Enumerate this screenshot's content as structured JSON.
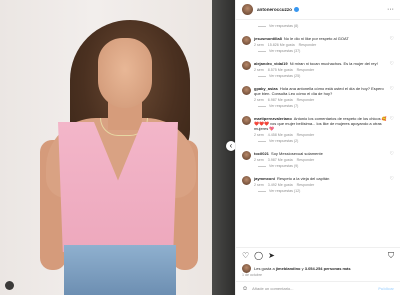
{
  "post": {
    "username": "antoneroccuzzo",
    "more_icon": "ellipsis-icon",
    "prev_nav_icon": "chevron-left-icon"
  },
  "comments": [
    {
      "id": "c0",
      "user": "",
      "text": "",
      "reply_toggle": "Ver respuestas (8)"
    },
    {
      "id": "c1",
      "user": "jesusmontilla8",
      "text": "No le dio ni like por respeto al GOAT",
      "time": "2 sem",
      "likes": "15.826 Me gusta",
      "reply": "Responder",
      "replies": "Ver respuestas (37)"
    },
    {
      "id": "c2",
      "user": "alejandro_vidal19",
      "text": "Ni miran ni tocan muchachos. Es la mujer del rey!",
      "time": "2 sem",
      "likes": "8.575 Me gusta",
      "reply": "Responder",
      "replies": "Ver respuestas (25)"
    },
    {
      "id": "c3",
      "user": "gpaky_asias",
      "text": "Hola ana antonella cómo está usted el día de hoy? Espero que bien. Consulta Leo cómo el día de hoy?",
      "time": "2 sem",
      "likes": "6.987 Me gusta",
      "reply": "Responder",
      "replies": "Ver respuestas (7)"
    },
    {
      "id": "c4",
      "user": "martiperezvaleriano",
      "text": "Antonio los comentarios de respeto de los chicos 🥰❤️❤️❤️ vos que mujer bellísima... los like de mujeres apoyando a otras mujeres 💖",
      "time": "2 sem",
      "likes": "4.458 Me gusta",
      "reply": "Responder",
      "replies": "Ver respuestas (2)"
    },
    {
      "id": "c5",
      "user": "tocil021",
      "text": "Soy Messiosexual solamente",
      "time": "2 sem",
      "likes": "3.987 Me gusta",
      "reply": "Responder",
      "replies": "Ver respuestas (9)"
    },
    {
      "id": "c6",
      "user": "jaymmxoni",
      "text": "Respeto a la viejа del capitán",
      "time": "2 sem",
      "likes": "3.492 Me gusta",
      "reply": "Responder",
      "replies": "Ver respuestas (12)"
    }
  ],
  "likes_line": {
    "prefix": "Les gusta a",
    "user": "jimeblandino",
    "middle": "y",
    "count": "3.054.254 personas más"
  },
  "date": "1 de octubre",
  "add_comment": {
    "placeholder": "Añade un comentario...",
    "publish": "Publicar"
  },
  "colors": {
    "accent": "#0095f6",
    "muted": "#8e8e8e"
  }
}
